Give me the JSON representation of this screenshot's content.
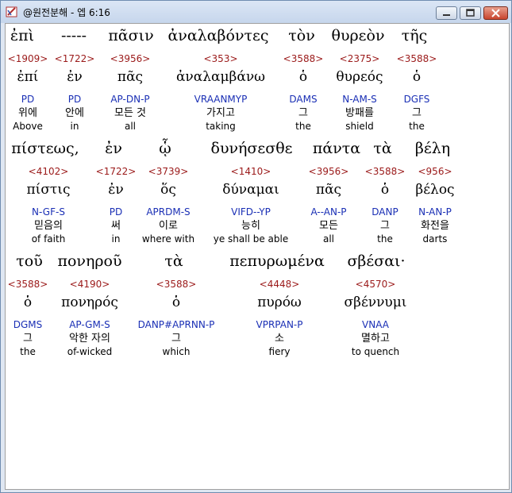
{
  "window": {
    "title": "@원전분해 - 엡 6:16"
  },
  "rows": [
    {
      "words": [
        {
          "greek": "ἐπὶ",
          "strong": "<1909>",
          "lemma": "ἐπί",
          "parsing": "PD",
          "korean": "위에",
          "english": "Above"
        },
        {
          "greek": "-----",
          "strong": "<1722>",
          "lemma": "ἐν",
          "parsing": "PD",
          "korean": "안에",
          "english": "in"
        },
        {
          "greek": "πᾶσιν",
          "strong": "<3956>",
          "lemma": "πᾶς",
          "parsing": "AP-DN-P",
          "korean": "모든 것",
          "english": "all"
        },
        {
          "greek": "ἀναλαβόντες",
          "strong": "<353>",
          "lemma": "ἀναλαμβάνω",
          "parsing": "VRAANMYP",
          "korean": "가지고",
          "english": "taking"
        },
        {
          "greek": "τὸν",
          "strong": "<3588>",
          "lemma": "ὁ",
          "parsing": "DAMS",
          "korean": "그",
          "english": "the"
        },
        {
          "greek": "θυρεὸν",
          "strong": "<2375>",
          "lemma": "θυρεός",
          "parsing": "N-AM-S",
          "korean": "방패를",
          "english": "shield"
        },
        {
          "greek": "τῆς",
          "strong": "<3588>",
          "lemma": "ὁ",
          "parsing": "DGFS",
          "korean": "그",
          "english": "the"
        }
      ]
    },
    {
      "words": [
        {
          "greek": "πίστεως,",
          "strong": "<4102>",
          "lemma": "πίστις",
          "parsing": "N-GF-S",
          "korean": "믿음의",
          "english": "of faith"
        },
        {
          "greek": "ἐν",
          "strong": "<1722>",
          "lemma": "ἐν",
          "parsing": "PD",
          "korean": "써",
          "english": "in"
        },
        {
          "greek": "ᾧ",
          "strong": "<3739>",
          "lemma": "ὅς",
          "parsing": "APRDM-S",
          "korean": "이로",
          "english": "where with"
        },
        {
          "greek": "δυνήσεσθε",
          "strong": "<1410>",
          "lemma": "δύναμαι",
          "parsing": "VIFD--YP",
          "korean": "능히",
          "english": "ye shall be able"
        },
        {
          "greek": "πάντα",
          "strong": "<3956>",
          "lemma": "πᾶς",
          "parsing": "A--AN-P",
          "korean": "모든",
          "english": "all"
        },
        {
          "greek": "τὰ",
          "strong": "<3588>",
          "lemma": "ὁ",
          "parsing": "DANP",
          "korean": "그",
          "english": "the"
        },
        {
          "greek": "βέλη",
          "strong": "<956>",
          "lemma": "βέλος",
          "parsing": "N-AN-P",
          "korean": "화전을",
          "english": "darts"
        }
      ]
    },
    {
      "words": [
        {
          "greek": "τοῦ",
          "strong": "<3588>",
          "lemma": "ὁ",
          "parsing": "DGMS",
          "korean": "그",
          "english": "the"
        },
        {
          "greek": "πονηροῦ",
          "strong": "<4190>",
          "lemma": "πονηρός",
          "parsing": "AP-GM-S",
          "korean": "악한 자의",
          "english": "of-wicked"
        },
        {
          "greek": "τὰ",
          "strong": "<3588>",
          "lemma": "ὁ",
          "parsing": "DANP#APRNN-P",
          "korean": "그",
          "english": "which"
        },
        {
          "greek": "πεπυρωμένα",
          "strong": "<4448>",
          "lemma": "πυρόω",
          "parsing": "VPRPAN-P",
          "korean": "소",
          "english": "fiery"
        },
        {
          "greek": "σβέσαι·",
          "strong": "<4570>",
          "lemma": "σβέννυμι",
          "parsing": "VNAA",
          "korean": "멸하고",
          "english": "to quench"
        }
      ]
    }
  ]
}
